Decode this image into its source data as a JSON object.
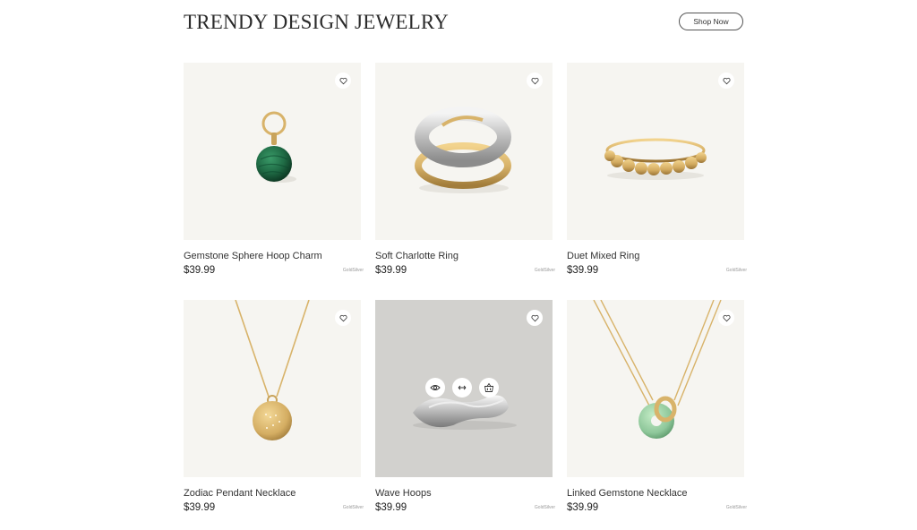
{
  "header": {
    "title": "TRENDY DESIGN JEWELRY",
    "shop_label": "Shop Now"
  },
  "products": [
    {
      "name": "Gemstone Sphere Hoop Charm",
      "price": "$39.99",
      "options": "GoldSilver",
      "icon": "heart-icon"
    },
    {
      "name": "Soft Charlotte Ring",
      "price": "$39.99",
      "options": "GoldSilver",
      "icon": "heart-icon"
    },
    {
      "name": "Duet Mixed Ring",
      "price": "$39.99",
      "options": "GoldSilver",
      "icon": "heart-icon"
    },
    {
      "name": "Zodiac Pendant Necklace",
      "price": "$39.99",
      "options": "GoldSilver",
      "icon": "heart-icon"
    },
    {
      "name": "Wave Hoops",
      "price": "$39.99",
      "options": "GoldSilver",
      "icon": "heart-icon",
      "hover_actions": [
        "eye-icon",
        "compare-arrows-icon",
        "basket-icon"
      ]
    },
    {
      "name": "Linked Gemstone Necklace",
      "price": "$39.99",
      "options": "GoldSilver",
      "icon": "heart-icon"
    }
  ],
  "colors": {
    "tile_background": "#f6f5f1",
    "hover_tile_background": "#d2d1ce",
    "gold": "#d8b36a",
    "malachite": "#1f6b45",
    "jade": "#8ec79a"
  }
}
